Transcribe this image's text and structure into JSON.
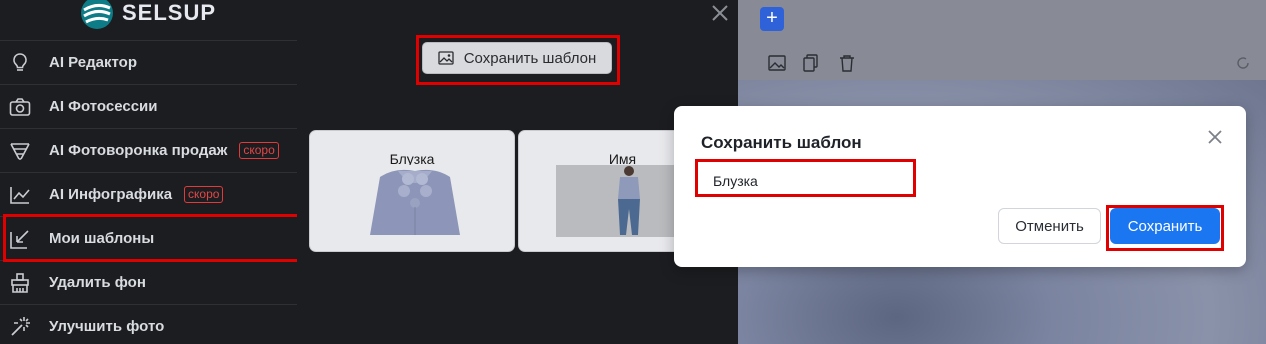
{
  "brand": {
    "name": "SELSUP"
  },
  "sidebar": {
    "items": [
      {
        "label": "AI Редактор",
        "icon": "lightbulb-icon"
      },
      {
        "label": "AI Фотосессии",
        "icon": "camera-icon"
      },
      {
        "label": "AI Фотоворонка продаж",
        "icon": "funnel-icon",
        "badge": "скоро"
      },
      {
        "label": "AI Инфографика",
        "icon": "line-chart-icon",
        "badge": "скоро"
      },
      {
        "label": "Мои шаблоны",
        "icon": "template-arrow-icon",
        "active": true
      },
      {
        "label": "Удалить фон",
        "icon": "brush-icon"
      },
      {
        "label": "Улучшить фото",
        "icon": "magic-wand-icon"
      }
    ]
  },
  "templates_panel": {
    "save_template_label": "Сохранить шаблон",
    "cards": [
      {
        "title": "Блузка"
      },
      {
        "title": "Имя"
      }
    ]
  },
  "modal": {
    "title": "Сохранить шаблон",
    "input_value": "Блузка",
    "cancel_label": "Отменить",
    "save_label": "Сохранить"
  },
  "colors": {
    "highlight": "#e00000",
    "primary": "#1b76f2",
    "badge": "#e04848"
  }
}
